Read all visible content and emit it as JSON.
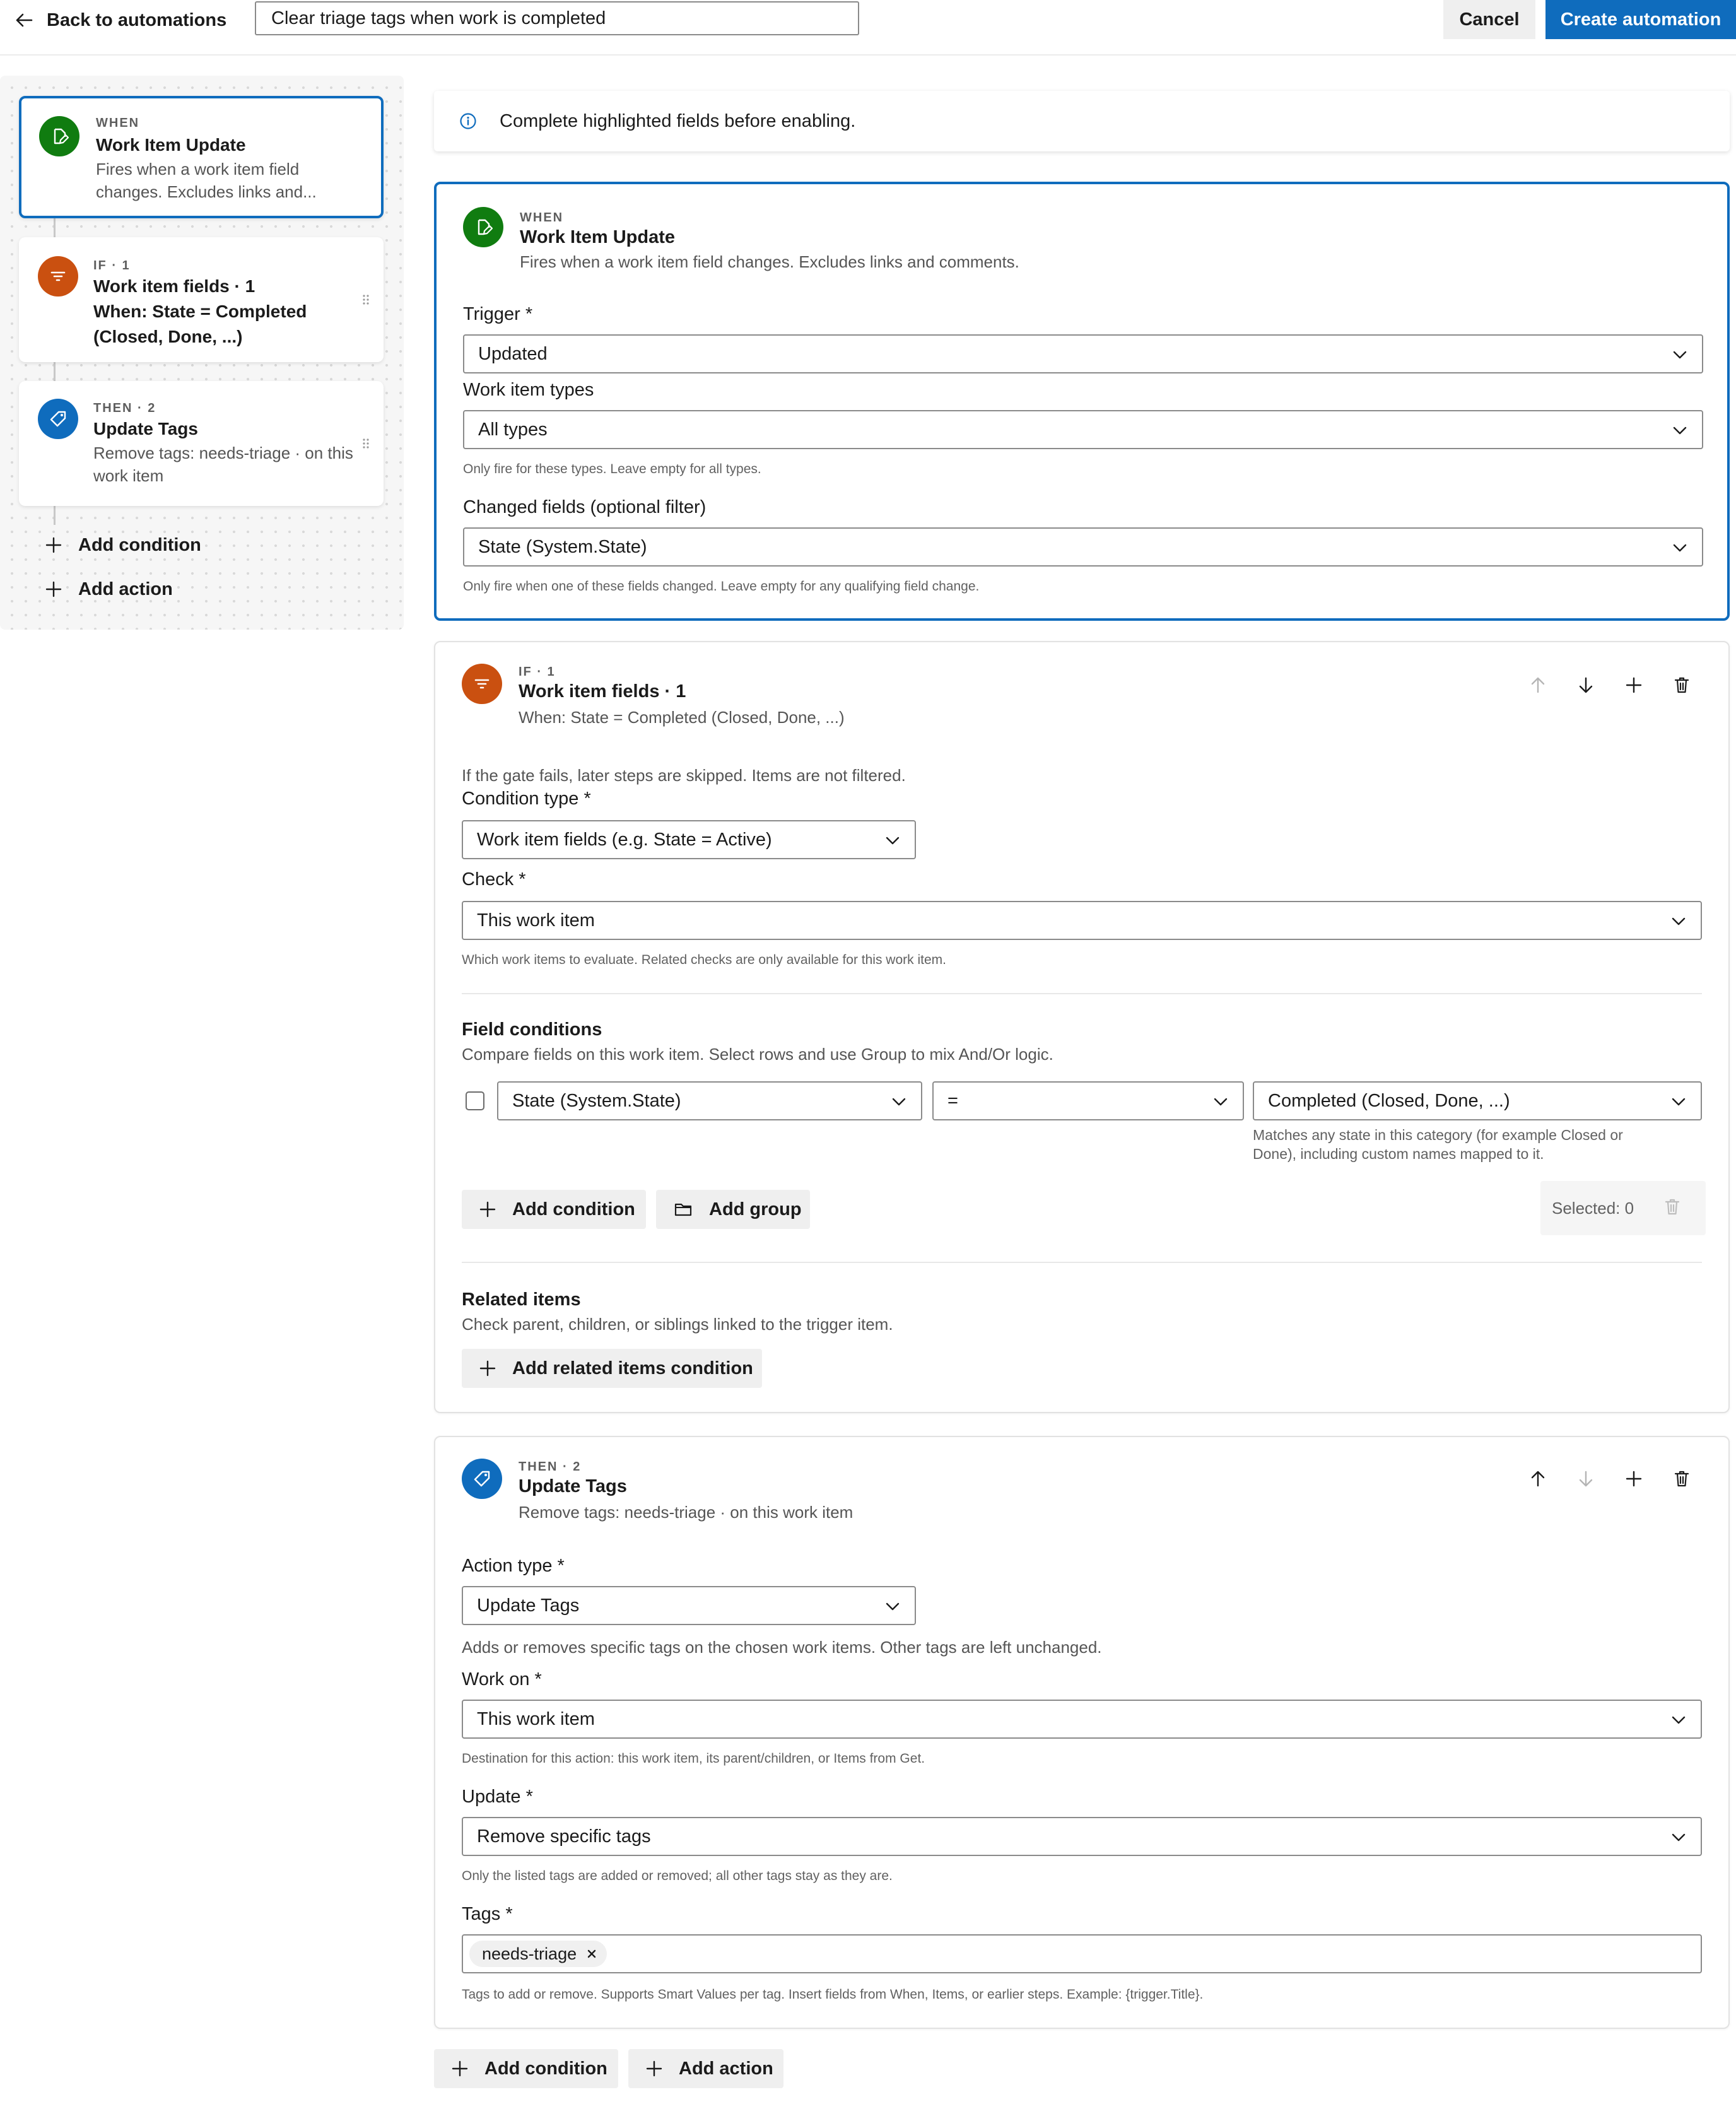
{
  "header": {
    "back_label": "Back to automations",
    "name_value": "Clear triage tags when work is completed",
    "cancel_label": "Cancel",
    "create_label": "Create automation"
  },
  "sidebar": {
    "steps": [
      {
        "label": "WHEN",
        "title": "Work Item Update",
        "description": "Fires when a work item field changes. Excludes links and...",
        "icon": "edit-document-icon",
        "color": "#107c10"
      },
      {
        "label": "IF · 1",
        "title": "Work item fields · 1",
        "description": "When: State = Completed (Closed, Done, ...)",
        "icon": "filter-icon",
        "color": "#ca5010"
      },
      {
        "label": "THEN · 2",
        "title": "Update Tags",
        "description": "Remove tags: needs-triage · on this work item",
        "icon": "tag-icon",
        "color": "#0f6cbd"
      }
    ],
    "add_condition_label": "Add condition",
    "add_action_label": "Add action"
  },
  "notice": {
    "icon": "info-icon",
    "text": "Complete highlighted fields before enabling."
  },
  "when_panel": {
    "label": "WHEN",
    "title": "Work Item Update",
    "description": "Fires when a work item field changes. Excludes links and comments.",
    "trigger_label": "Trigger *",
    "trigger_value": "Updated",
    "types_label": "Work item types",
    "types_value": "All types",
    "types_hint": "Only fire for these types. Leave empty for all types.",
    "changed_label": "Changed fields (optional filter)",
    "changed_value": "State (System.State)",
    "changed_hint": "Only fire when one of these fields changed. Leave empty for any qualifying field change."
  },
  "if_panel": {
    "label": "IF · 1",
    "title": "Work item fields · 1",
    "description": "When: State = Completed (Closed, Done, ...)",
    "gate_note": "If the gate fails, later steps are skipped. Items are not filtered.",
    "condition_type_label": "Condition type *",
    "condition_type_value": "Work item fields (e.g. State = Active)",
    "check_label": "Check *",
    "check_value": "This work item",
    "check_hint": "Which work items to evaluate. Related checks are only available for this work item.",
    "field_conditions_title": "Field conditions",
    "field_conditions_desc": "Compare fields on this work item. Select rows and use Group to mix And/Or logic.",
    "row": {
      "field": "State (System.State)",
      "operator": "=",
      "value": "Completed (Closed, Done, ...)",
      "value_hint_line1": "Matches any state in this category (for example Closed or",
      "value_hint_line2": "Done), including custom names mapped to it."
    },
    "add_condition_label": "Add condition",
    "add_group_label": "Add group",
    "selected_text": "Selected: 0",
    "related_title": "Related items",
    "related_desc": "Check parent, children, or siblings linked to the trigger item.",
    "add_related_label": "Add related items condition"
  },
  "then_panel": {
    "label": "THEN · 2",
    "title": "Update Tags",
    "description": "Remove tags: needs-triage · on this work item",
    "action_type_label": "Action type *",
    "action_type_value": "Update Tags",
    "action_type_hint": "Adds or removes specific tags on the chosen work items. Other tags are left unchanged.",
    "work_on_label": "Work on *",
    "work_on_value": "This work item",
    "work_on_hint": "Destination for this action: this work item, its parent/children, or Items from Get.",
    "update_label": "Update *",
    "update_value": "Remove specific tags",
    "update_hint": "Only the listed tags are added or removed; all other tags stay as they are.",
    "tags_label": "Tags *",
    "tags": [
      "needs-triage"
    ],
    "tags_hint": "Tags to add or remove. Supports Smart Values per tag. Insert fields from When, Items, or earlier steps. Example: {trigger.Title}."
  },
  "footer": {
    "add_condition_label": "Add condition",
    "add_action_label": "Add action"
  }
}
